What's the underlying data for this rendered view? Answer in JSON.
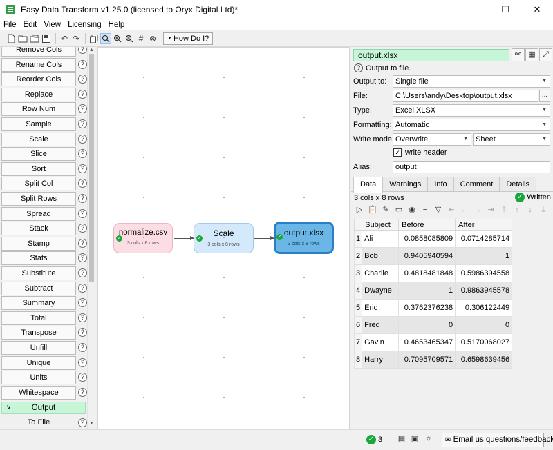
{
  "window": {
    "title": "Easy Data Transform v1.25.0 (licensed to Oryx Digital Ltd)*",
    "app_icon": "easy-data-transform-logo",
    "controls": [
      "—",
      "☐",
      "✕"
    ]
  },
  "menu": [
    "File",
    "Edit",
    "View",
    "Licensing",
    "Help"
  ],
  "toolbar": {
    "how_do_i": "How Do I?",
    "icons": [
      "new-file-icon",
      "open-folder-icon",
      "open-icon",
      "save-icon",
      "undo-icon",
      "redo-icon",
      "copy-icon",
      "search-icon",
      "zoom-in-icon",
      "zoom-out-icon",
      "grid-icon",
      "close-circle-icon"
    ]
  },
  "transforms": {
    "items": [
      "Remove Cols",
      "Rename Cols",
      "Reorder Cols",
      "Replace",
      "Row Num",
      "Sample",
      "Scale",
      "Slice",
      "Sort",
      "Split Col",
      "Split Rows",
      "Spread",
      "Stack",
      "Stamp",
      "Stats",
      "Substitute",
      "Subtract",
      "Summary",
      "Total",
      "Transpose",
      "Unfill",
      "Unique",
      "Units",
      "Whitespace"
    ],
    "category": "Output",
    "category_items": [
      "To File"
    ]
  },
  "canvas": {
    "nodes": [
      {
        "name": "normalize.csv",
        "info": "3 cols x 8 rows",
        "color": "#fbdde3"
      },
      {
        "name": "Scale",
        "info": "3 cols x 8 rows",
        "color": "#d4e9fb"
      },
      {
        "name": "output.xlsx",
        "info": "3 cols x 8 rows",
        "color": "#6ab6e7"
      }
    ]
  },
  "props": {
    "name": "output.xlsx",
    "description": "Output to file.",
    "output_to_label": "Output to:",
    "output_to": "Single file",
    "file_label": "File:",
    "file": "C:\\Users\\andy\\Desktop\\output.xlsx",
    "browse": "...",
    "type_label": "Type:",
    "type": "Excel XLSX",
    "formatting_label": "Formatting:",
    "formatting": "Automatic",
    "write_mode_label": "Write mode:",
    "write_mode": "Overwrite",
    "sheet": "Sheet",
    "write_header": "write header",
    "write_header_checked": true,
    "alias_label": "Alias:",
    "alias": "output"
  },
  "tabs": [
    "Data",
    "Warnings",
    "Info",
    "Comment",
    "Details"
  ],
  "data": {
    "rowcount": "3 cols x 8 rows",
    "status": "Written",
    "columns": [
      "Subject",
      "Before",
      "After"
    ],
    "rows": [
      [
        "1",
        "Ali",
        "0.0858085809",
        "0.0714285714"
      ],
      [
        "2",
        "Bob",
        "0.9405940594",
        "1"
      ],
      [
        "3",
        "Charlie",
        "0.4818481848",
        "0.5986394558"
      ],
      [
        "4",
        "Dwayne",
        "1",
        "0.9863945578"
      ],
      [
        "5",
        "Eric",
        "0.3762376238",
        "0.306122449"
      ],
      [
        "6",
        "Fred",
        "0",
        "0"
      ],
      [
        "7",
        "Gavin",
        "0.4653465347",
        "0.5170068027"
      ],
      [
        "8",
        "Harry",
        "0.7095709571",
        "0.6598639456"
      ]
    ]
  },
  "statusbar": {
    "count": "3",
    "email": "Email us questions/feedback"
  },
  "colors": {
    "accent_green": "#18a73a",
    "selected_green": "#c6f5d7",
    "node_pink": "#fbdde3",
    "node_blue": "#d4e9fb",
    "node_selected": "#6ab6e7"
  }
}
